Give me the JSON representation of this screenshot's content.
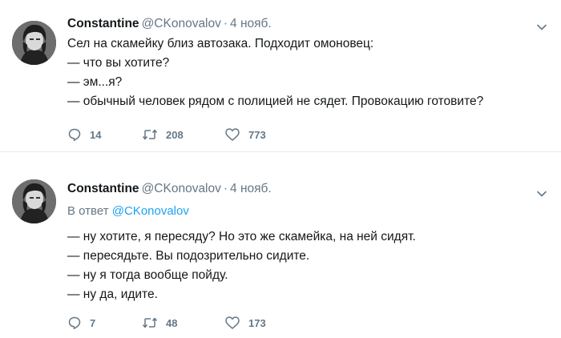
{
  "tweets": [
    {
      "author": {
        "name": "Constantine",
        "handle": "@CKonovalov",
        "avatar": "avatar-photo"
      },
      "separator": "·",
      "date": "4 нояб.",
      "reply_to": null,
      "lines": [
        "Сел на скамейку близ автозака. Подходит омоновец:",
        "— что вы хотите?",
        "— эм...я?",
        "— обычный человек рядом с полицией не сядет. Провокацию готовите?"
      ],
      "stats": {
        "replies": "14",
        "retweets": "208",
        "likes": "773"
      }
    },
    {
      "author": {
        "name": "Constantine",
        "handle": "@CKonovalov",
        "avatar": "avatar-photo"
      },
      "separator": "·",
      "date": "4 нояб.",
      "reply_to": {
        "prefix": "В ответ",
        "mention": "@CKonovalov"
      },
      "lines": [
        "— ну хотите, я пересяду? Но это же скамейка, на ней сидят.",
        "— пересядьте. Вы подозрительно сидите.",
        "— ну я тогда вообще пойду.",
        "— ну да, идите."
      ],
      "stats": {
        "replies": "7",
        "retweets": "48",
        "likes": "173"
      }
    }
  ],
  "icons": {
    "reply": "reply-bubble-icon",
    "retweet": "retweet-icon",
    "like": "heart-icon",
    "menu": "chevron-down-icon"
  },
  "colors": {
    "text": "#14171a",
    "secondary": "#657786",
    "link": "#1da1f2",
    "divider": "#e6ecf0"
  }
}
